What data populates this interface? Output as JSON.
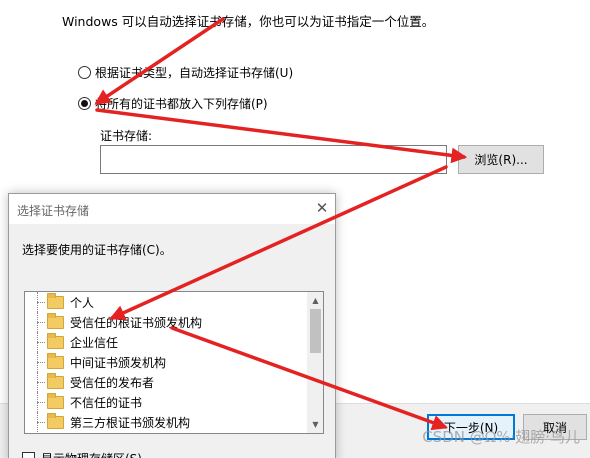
{
  "wizard": {
    "description": "Windows 可以自动选择证书存储，你也可以为证书指定一个位置。",
    "radio_auto_label": "根据证书类型，自动选择证书存储(U)",
    "radio_manual_label": "将所有的证书都放入下列存储(P)",
    "store_label": "证书存储:",
    "store_value": "",
    "browse_label": "浏览(R)...",
    "next_label": "下一步(N)",
    "cancel_label": "取消"
  },
  "dialog": {
    "title": "选择证书存储",
    "close_glyph": "✕",
    "prompt": "选择要使用的证书存储(C)。",
    "stores": [
      "个人",
      "受信任的根证书颁发机构",
      "企业信任",
      "中间证书颁发机构",
      "受信任的发布者",
      "不信任的证书",
      "第三方根证书颁发机构"
    ],
    "show_physical_label": "显示物理存储区(S)"
  },
  "watermark": "CSDN @Ω%·翅膀·鸟儿",
  "colors": {
    "arrow": "#e52222",
    "focus_blue": "#0078d7",
    "folder": "#f3cb62"
  },
  "icons": {
    "folder": "folder-icon",
    "close": "close-icon",
    "scroll_up": "chevron-up-icon",
    "scroll_down": "chevron-down-icon"
  }
}
